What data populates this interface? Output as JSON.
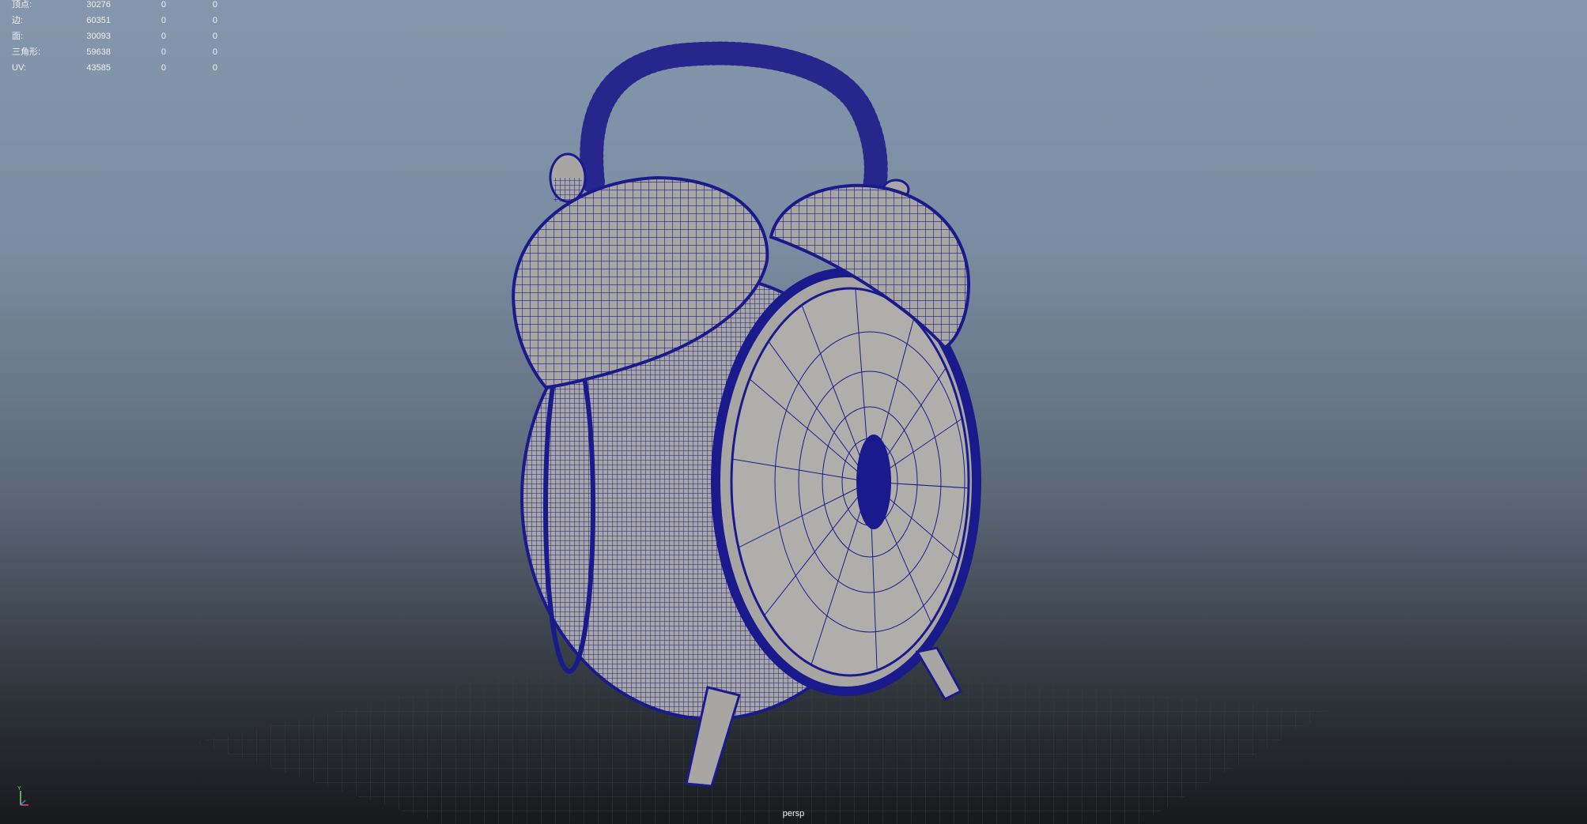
{
  "hud": {
    "rows": [
      {
        "label": "顶点:",
        "total": "30276",
        "selected": "0",
        "selected2": "0"
      },
      {
        "label": "边:",
        "total": "60351",
        "selected": "0",
        "selected2": "0"
      },
      {
        "label": "面:",
        "total": "30093",
        "selected": "0",
        "selected2": "0"
      },
      {
        "label": "三角形:",
        "total": "59638",
        "selected": "0",
        "selected2": "0"
      },
      {
        "label": "UV:",
        "total": "43585",
        "selected": "0",
        "selected2": "0"
      }
    ]
  },
  "viewport": {
    "camera_name": "persp",
    "axis": {
      "y_label": "Y"
    },
    "object": {
      "description_icon": "alarm-clock-wireframe",
      "wire_color": "#1a1a8c",
      "shade_color": "#a8a6a3"
    }
  }
}
